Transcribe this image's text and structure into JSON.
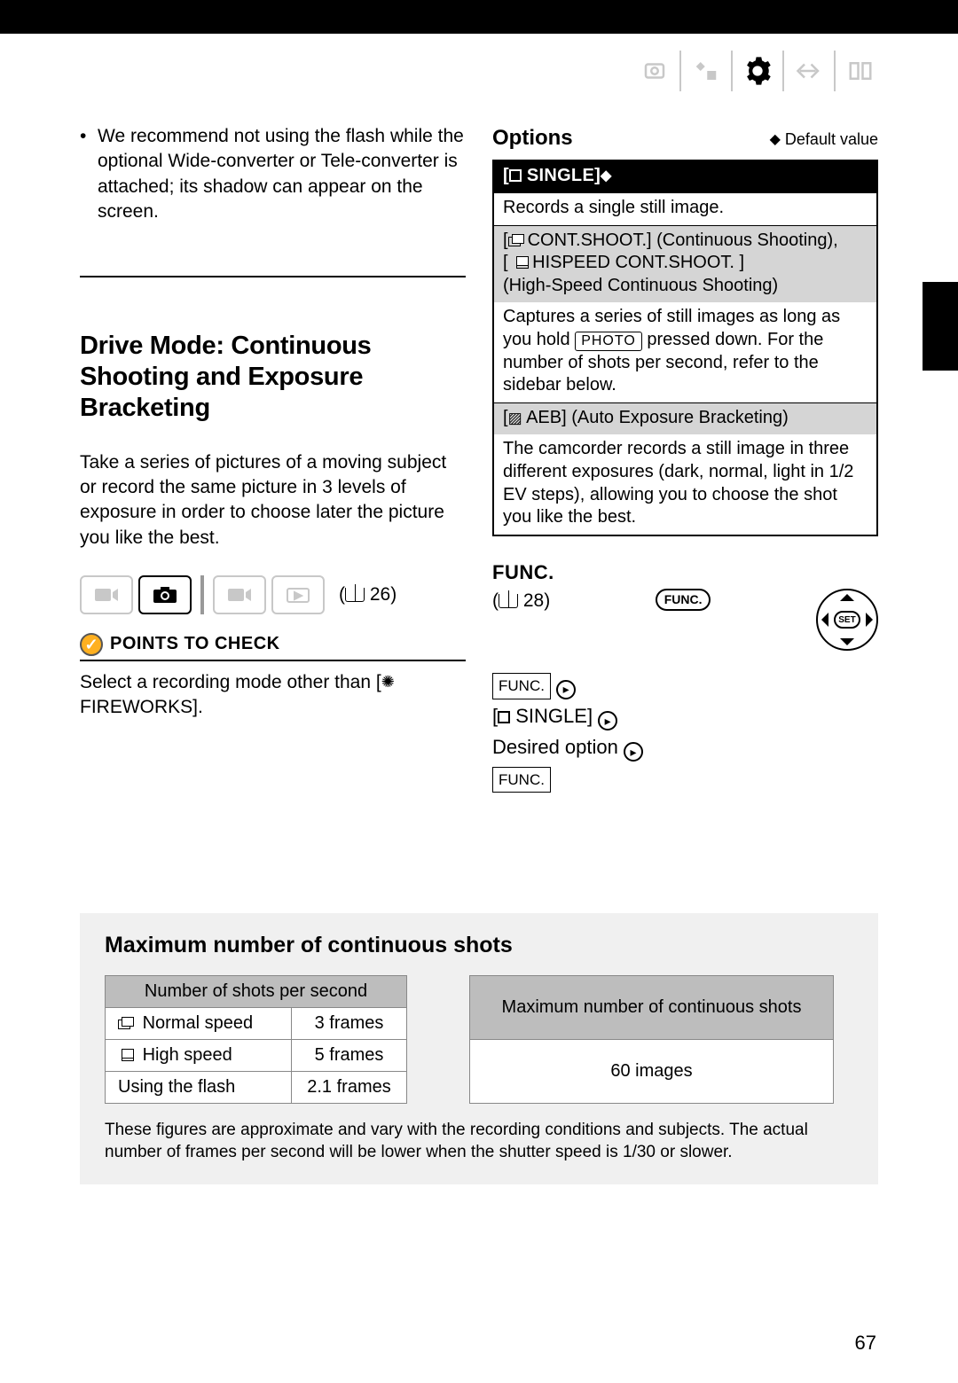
{
  "left": {
    "bullet1": "We recommend not using the flash while the optional Wide-converter or Tele-converter is attached; its shadow can appear on the screen.",
    "heading": "Drive Mode: Continuous Shooting and Exposure Bracketing",
    "intro": "Take a series of pictures of a moving subject or record the same picture in 3 levels of exposure in order to choose later the picture you like the best.",
    "mode_ref": "26",
    "points_label": "POINTS TO CHECK",
    "points_text1": "Select a recording mode other than",
    "points_text2": "FIREWORKS]."
  },
  "right": {
    "options_title": "Options",
    "default_note": "Default value",
    "single_label": "SINGLE]",
    "single_desc": "Records a single still image.",
    "cont_line1": "CONT.SHOOT.] (Continuous Shooting),",
    "cont_line2": "HISPEED CONT.SHOOT. ]",
    "cont_line3": "(High-Speed Continuous Shooting)",
    "cont_desc1": "Captures a series of still images as long as you hold",
    "cont_desc2": "pressed down. For the number of shots per second, refer to the sidebar below.",
    "aeb_label": "AEB] (Auto Exposure Bracketing)",
    "aeb_desc": "The camcorder records a still image in three different exposures (dark, normal, light in 1/2 EV steps), allowing you to choose the shot you like the best.",
    "func_heading": "FUNC.",
    "func_ref": "28",
    "func_oval": "FUNC.",
    "func_box": "FUNC.",
    "step_single": "SINGLE]",
    "step_desired": "Desired option",
    "photo_label": "PHOTO",
    "dpad_center": "SET"
  },
  "bottom": {
    "title": "Maximum number of continuous shots",
    "left_header": "Number of shots per second",
    "rows": [
      {
        "label": "Normal speed",
        "val": "3 frames"
      },
      {
        "label": "High speed",
        "val": "5 frames"
      },
      {
        "label": "Using the flash",
        "val": "2.1 frames"
      }
    ],
    "right_header": "Maximum number of continuous shots",
    "right_val": "60 images",
    "footnote": "These figures are approximate and vary with the recording conditions and subjects. The actual number of frames per second will be lower when the shutter speed is 1/30 or slower."
  },
  "page_number": "67"
}
